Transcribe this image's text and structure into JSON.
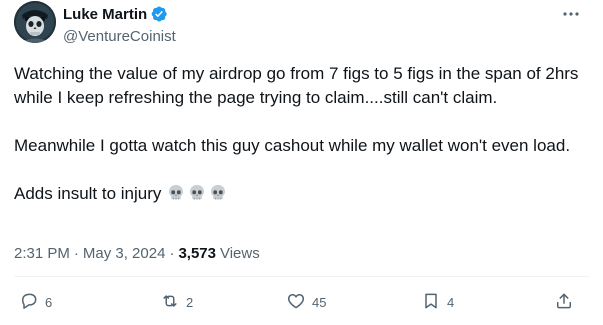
{
  "author": {
    "display_name": "Luke Martin",
    "handle": "@VentureCoinist",
    "verified": true
  },
  "tweet": {
    "paragraphs": [
      "Watching the value of my airdrop go from 7 figs to 5 figs in the span of 2hrs while I keep refreshing the page trying to claim....still can't claim.",
      "Meanwhile I gotta watch this guy cashout while my wallet won't even load.",
      "Adds insult to injury"
    ],
    "emoji": "skull-emoji x3",
    "time": "2:31 PM",
    "date": "May 3, 2024",
    "separator": "·",
    "views_count": "3,573",
    "views_label": "Views"
  },
  "actions": {
    "replies": "6",
    "reposts": "2",
    "likes": "45",
    "bookmarks": "4"
  },
  "colors": {
    "text": "#0f1419",
    "secondary": "#536471",
    "verified": "#1d9bf0",
    "divider": "#eff3f4"
  }
}
